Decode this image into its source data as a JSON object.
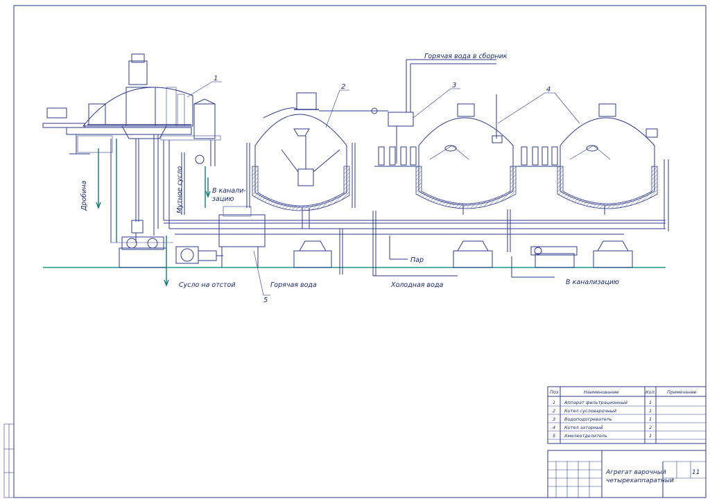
{
  "labels": {
    "hot_water_collector": "Горячая вода в сборник",
    "to_sewer_1": "В канали-",
    "to_sewer_1b": "зацию",
    "cloudy_wort": "Мутное сусло",
    "spent_grain": "Дробина",
    "wort_settle": "Сусло на отстой",
    "hot_water": "Горячая вода",
    "cold_water": "Холодная вода",
    "steam": "Пар",
    "to_sewer_2": "В канализацию"
  },
  "callouts": [
    "1",
    "2",
    "3",
    "4",
    "5"
  ],
  "spec": {
    "headers": {
      "pos": "Поз",
      "name": "Наименование",
      "qty": "Кол.",
      "note": "Примечание"
    },
    "rows": [
      {
        "pos": "1",
        "name": "Аппарат фильтрационный",
        "qty": "1"
      },
      {
        "pos": "2",
        "name": "Котел сусловарочный",
        "qty": "1"
      },
      {
        "pos": "3",
        "name": "Водоподогреватель",
        "qty": "1"
      },
      {
        "pos": "4",
        "name": "Котел заторный",
        "qty": "2"
      },
      {
        "pos": "5",
        "name": "Хмелеотделитель",
        "qty": "1"
      }
    ]
  },
  "titleblock": {
    "title_line1": "Агрегат варочный",
    "title_line2": "четырехаппаратный",
    "sheet_no": "11"
  },
  "colors": {
    "lines": "#2b3a8a",
    "floor": "#1f9a8a",
    "flow": "#127a7a"
  }
}
